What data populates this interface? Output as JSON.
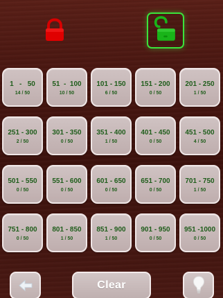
{
  "levels": [
    {
      "range": "1   -   50",
      "progress": "14 / 50"
    },
    {
      "range": "51  -  100",
      "progress": "10 / 50"
    },
    {
      "range": "101 - 150",
      "progress": "6 / 50"
    },
    {
      "range": "151 - 200",
      "progress": "0 / 50"
    },
    {
      "range": "201 - 250",
      "progress": "1 / 50"
    },
    {
      "range": "251 - 300",
      "progress": "2 / 50"
    },
    {
      "range": "301 - 350",
      "progress": "0 / 50"
    },
    {
      "range": "351 - 400",
      "progress": "1 / 50"
    },
    {
      "range": "401 - 450",
      "progress": "0 / 50"
    },
    {
      "range": "451 - 500",
      "progress": "4 / 50"
    },
    {
      "range": "501 - 550",
      "progress": "0 / 50"
    },
    {
      "range": "551 - 600",
      "progress": "0 / 50"
    },
    {
      "range": "601 - 650",
      "progress": "0 / 50"
    },
    {
      "range": "651 - 700",
      "progress": "0 / 50"
    },
    {
      "range": "701 - 750",
      "progress": "1 / 50"
    },
    {
      "range": "751 - 800",
      "progress": "0 / 50"
    },
    {
      "range": "801 - 850",
      "progress": "1 / 50"
    },
    {
      "range": "851 - 900",
      "progress": "1 / 50"
    },
    {
      "range": "901 - 950",
      "progress": "0 / 50"
    },
    {
      "range": "951 -1000",
      "progress": "0 / 50"
    }
  ],
  "bottom": {
    "clear_label": "Clear"
  },
  "icons": {
    "locked": "lock-icon",
    "unlocked": "unlock-icon",
    "back": "back-arrow-icon",
    "hint": "lightbulb-icon"
  },
  "colors": {
    "lock_red": "#e00000",
    "lock_green": "#19b419",
    "text_green": "#1f5d1b"
  }
}
